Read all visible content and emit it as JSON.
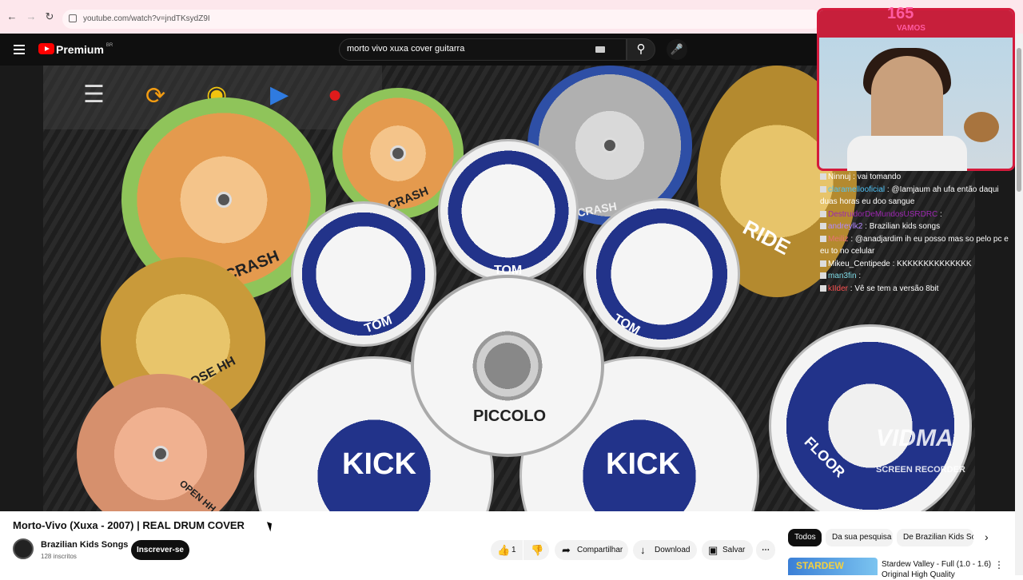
{
  "browser": {
    "url": "youtube.com/watch?v=jndTKsydZ9I",
    "icons": [
      "back-arrow-icon",
      "forward-arrow-icon",
      "reload-icon",
      "site-info-icon"
    ]
  },
  "youtube": {
    "brand": "Premium",
    "brand_region": "BR",
    "search_query": "morto vivo xuxa cover guitarra"
  },
  "video": {
    "drums": {
      "crash_left": "CRASH",
      "crash_right": "CRASH",
      "crash_top": "CRASH",
      "ride": "RIDE",
      "tom_left": "TOM",
      "tom_center": "TOM",
      "tom_right": "TOM",
      "close_hh": "CLOSE HH",
      "open_hh": "OPEN HH",
      "piccolo": "PICCOLO",
      "kick_left": "KICK",
      "kick_right": "KICK",
      "floor": "FLOOR"
    },
    "watermark_logo": "VIDMA",
    "watermark_text": "SCREEN RECORDER",
    "cam_counter": "165",
    "cam_label": "VAMOS"
  },
  "chat": [
    {
      "user": "Ninnuj",
      "text": ": vai tomando",
      "color": "#ffffff"
    },
    {
      "user": "claramellooficial",
      "text": ": @Iamjaum ah ufa então daqui duas horas eu doo sangue",
      "color": "#4fc3f7"
    },
    {
      "user": "DestruidorDeMundosUSRDRC",
      "text": ":",
      "color": "#9c27b0"
    },
    {
      "user": "andreylk2",
      "text": ": Brazilian kids songs",
      "color": "#b388ff"
    },
    {
      "user": "Meiliz",
      "text": ": @anadjardim ih eu posso mas so pelo pc e eu to no celular",
      "color": "#e57373"
    },
    {
      "user": "Mikeu_Centipede",
      "text": ": KKKKKKKKKKKKKK",
      "color": "#ffffff"
    },
    {
      "user": "man3fin",
      "text": ":",
      "color": "#80deea"
    },
    {
      "user": "kIIder",
      "text": ": Vê se tem a versão 8bit",
      "color": "#ff5252"
    }
  ],
  "meta": {
    "title": "Morto-Vivo (Xuxa - 2007) | REAL DRUM COVER",
    "channel": "Brazilian Kids Songs",
    "subscribers": "128 inscritos",
    "subscribe_label": "Inscrever-se",
    "likes": "1",
    "share_label": "Compartilhar",
    "download_label": "Download",
    "save_label": "Salvar"
  },
  "chips": [
    "Todos",
    "Da sua pesquisa",
    "De Brazilian Kids Songs"
  ],
  "recommendation": {
    "thumb_text": "STARDEW",
    "title": "Stardew Valley - Full (1.0 - 1.6)",
    "subtitle": "Original High Quality"
  }
}
